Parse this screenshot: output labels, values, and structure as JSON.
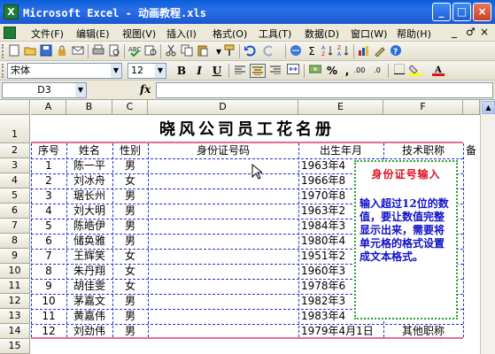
{
  "window": {
    "title": "Microsoft Excel - 动画教程.xls",
    "app_icon": "X"
  },
  "window_controls": {
    "minimize": "_",
    "maximize": "□",
    "close": "×"
  },
  "menu": {
    "items": [
      "文件(F)",
      "编辑(E)",
      "视图(V)",
      "插入(I)",
      "格式(O)",
      "工具(T)",
      "数据(D)",
      "窗口(W)",
      "帮助(H)"
    ],
    "controls": [
      "_",
      "♂",
      "×"
    ]
  },
  "format_toolbar": {
    "font_name": "宋体",
    "font_size": "12",
    "bold": "B",
    "italic": "I",
    "underline": "U",
    "percent": "%",
    "comma": ",",
    "dec_increase": ".00",
    "dec_decrease": ".0"
  },
  "formula_bar": {
    "name_box": "D3",
    "fx": "fx",
    "formula": ""
  },
  "columns": [
    "A",
    "B",
    "C",
    "D",
    "E",
    "F"
  ],
  "rows": [
    "1",
    "2",
    "3",
    "4",
    "5",
    "6",
    "7",
    "8",
    "9",
    "10",
    "11",
    "12",
    "13",
    "14",
    "15"
  ],
  "sheet": {
    "title": "晓风公司员工花名册",
    "headers": [
      "序号",
      "姓名",
      "性别",
      "身份证号码",
      "出生年月",
      "技术职称",
      "备"
    ],
    "records": [
      {
        "no": "1",
        "name": "陈一平",
        "gender": "男",
        "birth": "1963年4"
      },
      {
        "no": "2",
        "name": "刘冰舟",
        "gender": "女",
        "birth": "1966年8"
      },
      {
        "no": "3",
        "name": "琚长州",
        "gender": "男",
        "birth": "1970年8"
      },
      {
        "no": "4",
        "name": "刘大明",
        "gender": "男",
        "birth": "1963年2"
      },
      {
        "no": "5",
        "name": "陈皓伊",
        "gender": "男",
        "birth": "1984年3"
      },
      {
        "no": "6",
        "name": "储奂雅",
        "gender": "男",
        "birth": "1980年4"
      },
      {
        "no": "7",
        "name": "王辉笑",
        "gender": "女",
        "birth": "1951年2"
      },
      {
        "no": "8",
        "name": "朱丹翔",
        "gender": "女",
        "birth": "1960年3"
      },
      {
        "no": "9",
        "name": "胡佳雯",
        "gender": "女",
        "birth": "1978年6"
      },
      {
        "no": "10",
        "name": "茅嘉文",
        "gender": "男",
        "birth": "1982年3"
      },
      {
        "no": "11",
        "name": "黄嘉伟",
        "gender": "男",
        "birth": "1983年4"
      },
      {
        "no": "12",
        "name": "刘劲伟",
        "gender": "男",
        "birth": "1979年4月1日",
        "title": "其他职称"
      }
    ]
  },
  "callout": {
    "title": "身份证号输入",
    "body": "输入超过12位的数值，要让数值完整显示出来，需要将单元格的格式设置成文本格式。"
  },
  "colors": {
    "accent_dash": "#1b2fd6",
    "callout_title": "#e01020",
    "callout_body": "#1010c8",
    "callout_border": "#22a02a",
    "red_rule": "#e0708a"
  }
}
